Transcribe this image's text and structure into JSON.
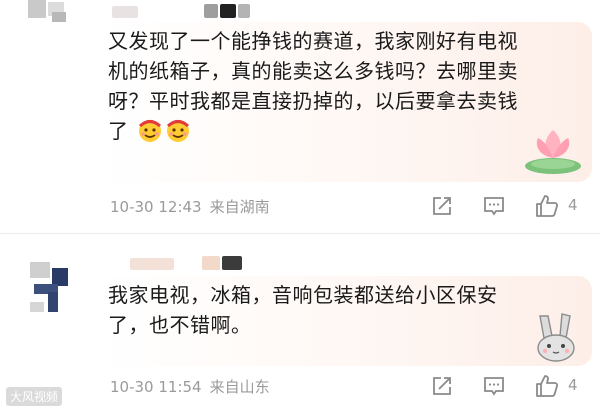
{
  "comments": [
    {
      "text": "又发现了一个能挣钱的赛道，我家刚好有电视机的纸箱子，真的能卖这么多钱吗？去哪里卖呀？平时我都是直接扔掉的，以后要拿去卖钱了",
      "emojis": [
        "smiling-face-icon",
        "smiling-face-icon"
      ],
      "time": "10-30 12:43",
      "location": "来自湖南",
      "likes": "4"
    },
    {
      "text": "我家电视，冰箱，音响包装都送给小区保安了，也不错啊。",
      "time": "10-30 11:54",
      "location": "来自山东",
      "likes": "4"
    }
  ],
  "watermark": "大风视频",
  "colors": {
    "meta": "#9a9a9a",
    "text": "#1a1a1a",
    "bubble_accent": "#fdeee8"
  }
}
